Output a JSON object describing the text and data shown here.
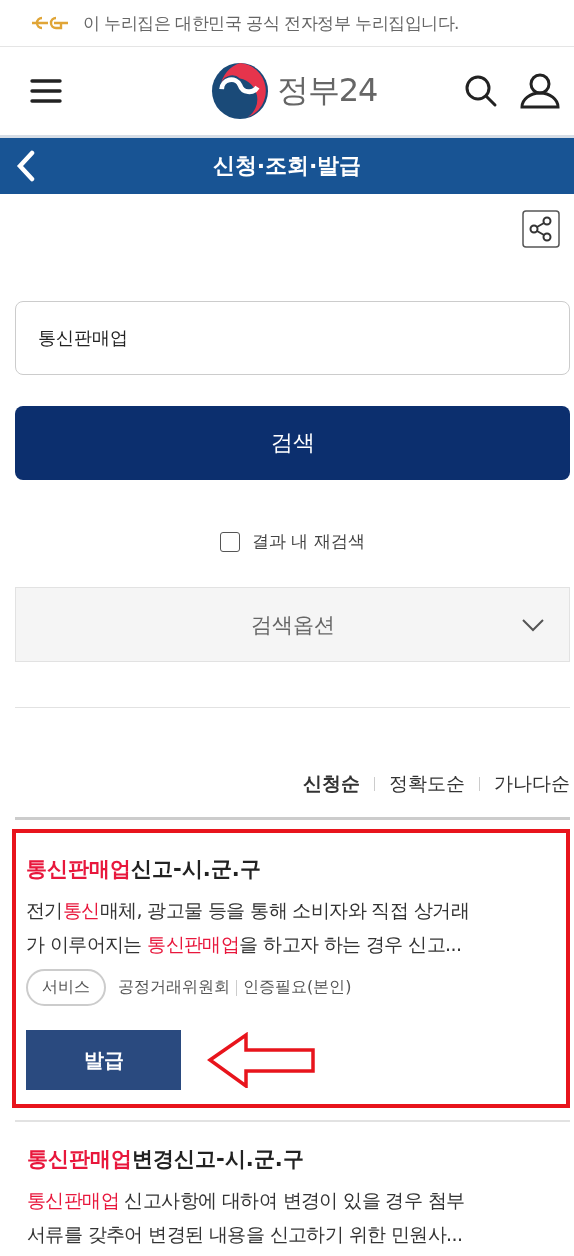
{
  "notice": {
    "text": "이 누리집은 대한민국 공식 전자정부 누리집입니다."
  },
  "header": {
    "logo_text": "정부24"
  },
  "title_bar": {
    "title": "신청·조회·발급"
  },
  "search": {
    "value": "통신판매업",
    "button": "검색",
    "rescan": {
      "label": "결과 내 재검색",
      "checked": false
    },
    "options": {
      "label": "검색옵션",
      "expanded": false
    }
  },
  "sort": [
    {
      "label": "신청순",
      "selected": true
    },
    {
      "label": "정확도순",
      "selected": false
    },
    {
      "label": "가나다순",
      "selected": false
    }
  ],
  "results": [
    {
      "annotated": true,
      "title": [
        {
          "text": "통신판매업",
          "highlight": true
        },
        {
          "text": "신고-시.군.구",
          "highlight": false
        }
      ],
      "lines": [
        [
          {
            "text": "전기",
            "highlight": false
          },
          {
            "text": "통신",
            "highlight": true
          },
          {
            "text": "매체, 광고물 등을 통해 소비자와 직접 상거래",
            "highlight": false
          }
        ],
        [
          {
            "text": "가 이루어지는 ",
            "highlight": false
          },
          {
            "text": "통신판매업",
            "highlight": true
          },
          {
            "text": "을 하고자 하는 경우 신고...",
            "highlight": false
          }
        ]
      ],
      "tag": "서비스",
      "agency": "공정거래위원회",
      "auth": "인증필요(본인)",
      "button": "발급"
    },
    {
      "annotated": false,
      "title": [
        {
          "text": "통신판매업",
          "highlight": true
        },
        {
          "text": "변경신고-시.군.구",
          "highlight": false
        }
      ],
      "lines": [
        [
          {
            "text": "통신판매업",
            "highlight": true
          },
          {
            "text": " 신고사항에 대하여 변경이 있을 경우 첨부",
            "highlight": false
          }
        ],
        [
          {
            "text": "서류를 갖추어 변경된 내용을 신고하기 위한 민원사...",
            "highlight": false
          }
        ]
      ]
    }
  ]
}
